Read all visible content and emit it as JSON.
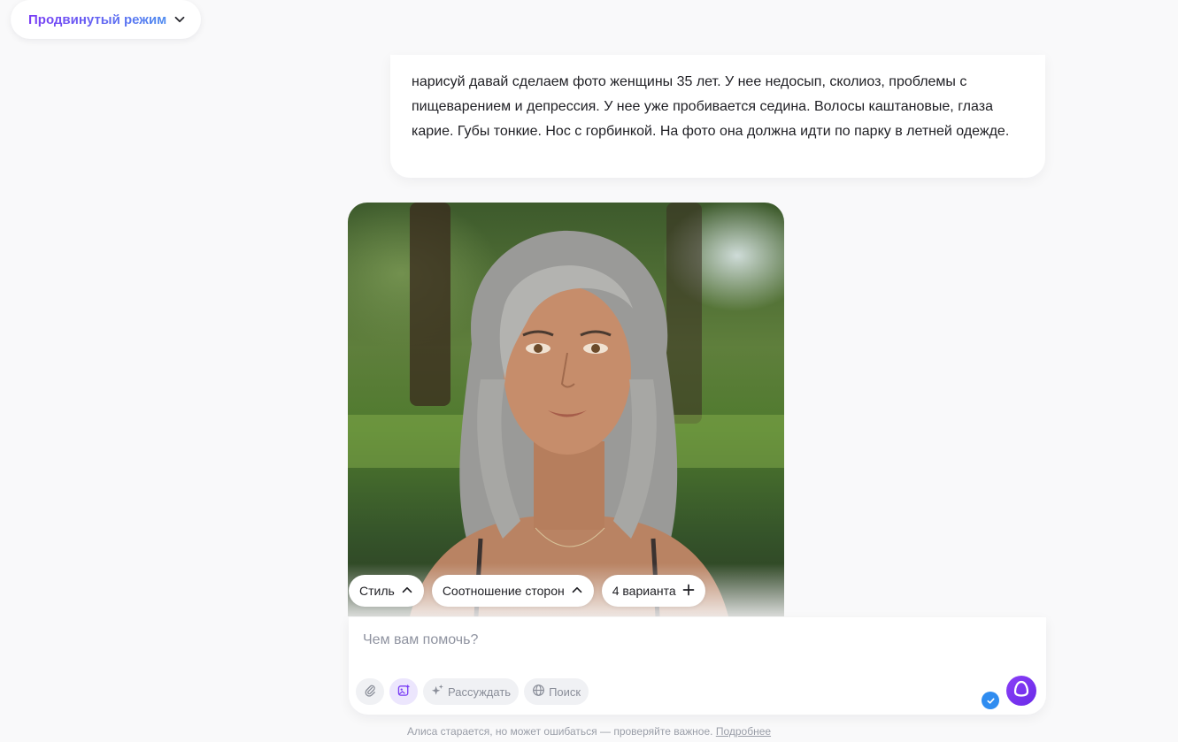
{
  "header": {
    "mode_label": "Продвинутый режим",
    "mode_icon": "chevron-down-icon"
  },
  "chat": {
    "user_message": "нарисуй давай сделаем фото женщины 35 лет. У нее недосып, сколиоз, проблемы с пищеварением и депрессия. У нее уже пробивается седина. Волосы каштановые, глаза карие. Губы тонкие. Нос с горбинкой. На фото она должна идти по парку в летней одежде.",
    "image": {
      "controls": [
        {
          "label": "Стиль",
          "icon": "chevron-up-icon"
        },
        {
          "label": "Соотношение сторон",
          "icon": "chevron-up-icon"
        },
        {
          "label": "4 варианта",
          "icon": "plus-icon"
        }
      ]
    }
  },
  "composer": {
    "placeholder": "Чем вам помочь?",
    "tools": {
      "attach_icon": "paperclip-icon",
      "image_gen_icon": "image-sparkle-icon",
      "reason_label": "Рассуждать",
      "reason_icon": "sparkle-icon",
      "search_label": "Поиск",
      "search_icon": "globe-icon"
    },
    "send_icon": "alice-icon",
    "status_icon": "check-icon"
  },
  "footer": {
    "disclaimer": "Алиса старается, но может ошибаться — проверяйте важное.",
    "link": "Подробнее"
  },
  "colors": {
    "accent_purple": "#7a3df5",
    "accent_blue": "#4f8cf0",
    "page_bg": "#f9f9fa",
    "check_blue": "#2f8cf0"
  }
}
